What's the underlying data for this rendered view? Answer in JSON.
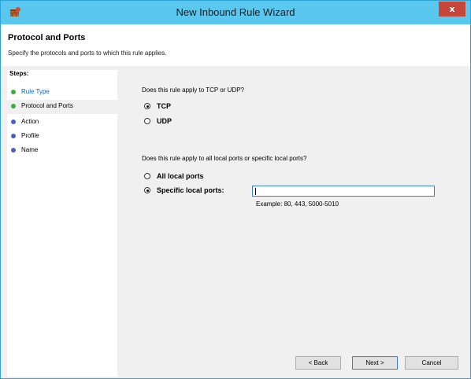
{
  "window": {
    "title": "New Inbound Rule Wizard",
    "close_label": "x"
  },
  "header": {
    "title": "Protocol and Ports",
    "description": "Specify the protocols and ports to which this rule applies."
  },
  "steps": {
    "title": "Steps:",
    "items": [
      {
        "label": "Rule Type",
        "status": "completed",
        "dot_color": "#3cae3c",
        "link": true
      },
      {
        "label": "Protocol and Ports",
        "status": "current",
        "dot_color": "#3cae3c",
        "link": false
      },
      {
        "label": "Action",
        "status": "pending",
        "dot_color": "#4a5fc4",
        "link": false
      },
      {
        "label": "Profile",
        "status": "pending",
        "dot_color": "#4a5fc4",
        "link": false
      },
      {
        "label": "Name",
        "status": "pending",
        "dot_color": "#4a5fc4",
        "link": false
      }
    ]
  },
  "protocol": {
    "question": "Does this rule apply to TCP or UDP?",
    "options": [
      {
        "label": "TCP",
        "checked": true
      },
      {
        "label": "UDP",
        "checked": false
      }
    ]
  },
  "ports": {
    "question": "Does this rule apply to all local ports or specific local ports?",
    "options": [
      {
        "label": "All local ports",
        "checked": false
      },
      {
        "label": "Specific local ports:",
        "checked": true
      }
    ],
    "input_value": "",
    "example": "Example: 80, 443, 5000-5010"
  },
  "buttons": {
    "back": "< Back",
    "next": "Next >",
    "cancel": "Cancel"
  },
  "colors": {
    "titlebar": "#5ac8ee",
    "close_button": "#c7463a",
    "link_blue": "#0066cc"
  }
}
